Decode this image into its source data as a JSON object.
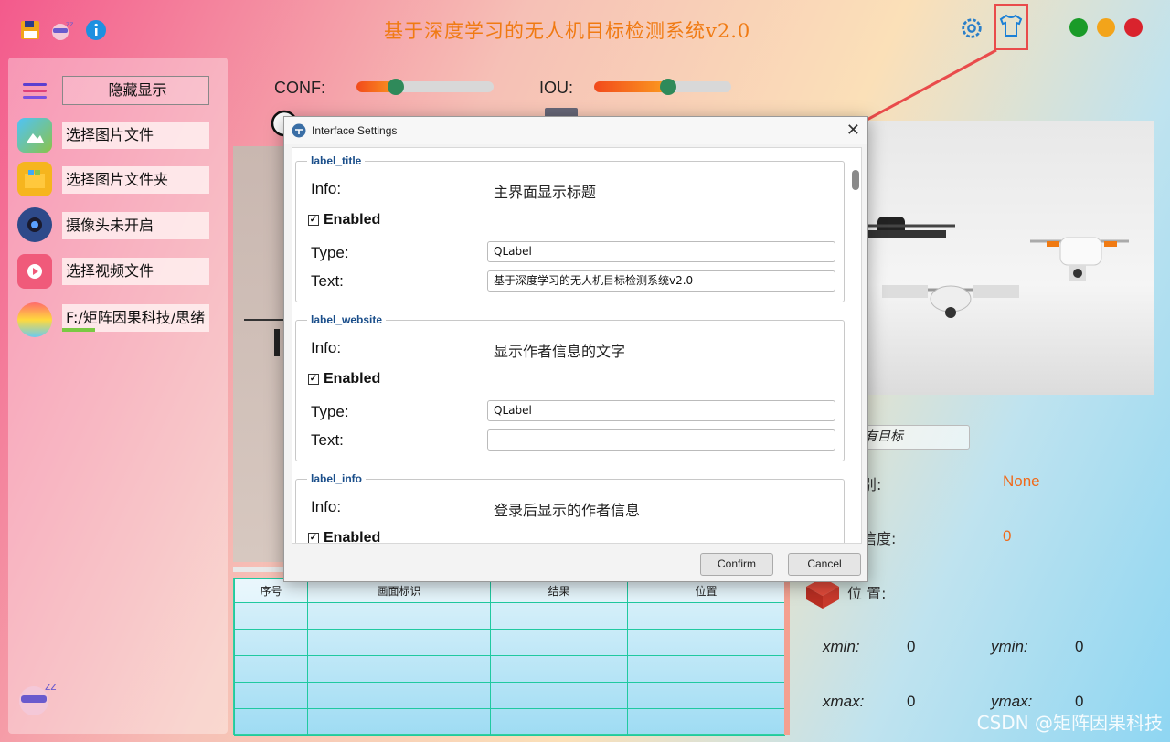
{
  "header": {
    "title": "基于深度学习的无人机目标检测系统v2.0",
    "colors": {
      "title": "#f07a12",
      "green": "#1a9b28",
      "yellow": "#f3a41a",
      "red": "#d9232d"
    }
  },
  "sidebar": {
    "toggle_label": "隐藏显示",
    "items": [
      {
        "label": "选择图片文件",
        "icon": "image-file-icon"
      },
      {
        "label": "选择图片文件夹",
        "icon": "folder-icon"
      },
      {
        "label": "摄像头未开启",
        "icon": "camera-icon"
      },
      {
        "label": "选择视频文件",
        "icon": "video-file-icon"
      },
      {
        "label": "F:/矩阵因果科技/思绪",
        "icon": "model-icon"
      }
    ]
  },
  "controls": {
    "conf_label": "CONF:",
    "conf_value": 0.3,
    "iou_label": "IOU:",
    "iou_value": 0.5
  },
  "results": {
    "target_select": "有目标",
    "class_label": "别:",
    "class_value": "None",
    "confidence_label": "信度:",
    "confidence_value": "0",
    "position_label": "位 置:",
    "xmin_label": "xmin:",
    "xmin": "0",
    "ymin_label": "ymin:",
    "ymin": "0",
    "xmax_label": "xmax:",
    "xmax": "0",
    "ymax_label": "ymax:",
    "ymax": "0"
  },
  "table": {
    "headers": [
      "序号",
      "画面标识",
      "结果",
      "位置"
    ]
  },
  "dialog": {
    "title": "Interface Settings",
    "groups": [
      {
        "name": "label_title",
        "info_label": "Info:",
        "info": "主界面显示标题",
        "enabled": "Enabled",
        "type_label": "Type:",
        "type": "QLabel",
        "text_label": "Text:",
        "text": "基于深度学习的无人机目标检测系统v2.0"
      },
      {
        "name": "label_website",
        "info_label": "Info:",
        "info": "显示作者信息的文字",
        "enabled": "Enabled",
        "type_label": "Type:",
        "type": "QLabel",
        "text_label": "Text:",
        "text": ""
      },
      {
        "name": "label_info",
        "info_label": "Info:",
        "info": "登录后显示的作者信息",
        "enabled": "Enabled"
      }
    ],
    "confirm": "Confirm",
    "cancel": "Cancel"
  },
  "watermark": "CSDN @矩阵因果科技"
}
